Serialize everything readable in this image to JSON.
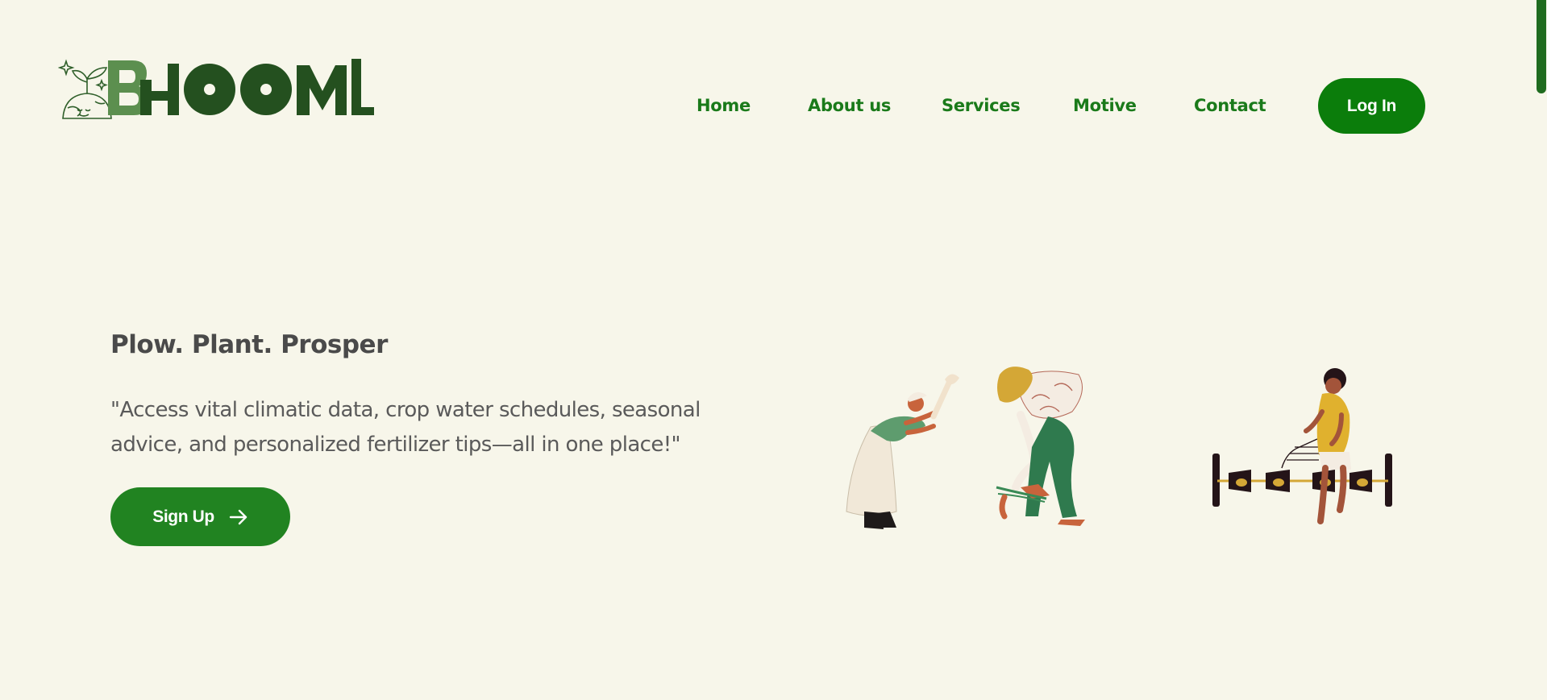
{
  "header": {
    "logo_text": "BHOOMI",
    "nav": {
      "home": "Home",
      "about": "About us",
      "services": "Services",
      "motive": "Motive",
      "contact": "Contact"
    },
    "login_label": "Log In"
  },
  "hero": {
    "title": "Plow. Plant. Prosper",
    "description": "\"Access vital climatic data, crop water schedules, seasonal advice, and personalized fertilizer tips—all in one place!\"",
    "signup_label": "Sign Up",
    "signup_icon": "arrow-right-icon"
  },
  "illustration": {
    "figures": [
      "farmer-with-hammer",
      "farmer-planting-seedlings",
      "farmer-with-plough"
    ]
  },
  "colors": {
    "background": "#f7f6ea",
    "primary_green": "#0b7d0b",
    "button_green": "#218321",
    "nav_text": "#1a7a1a",
    "logo_dark": "#24501f",
    "logo_light": "#5c8f4f",
    "heading_text": "#4a4a4a"
  }
}
